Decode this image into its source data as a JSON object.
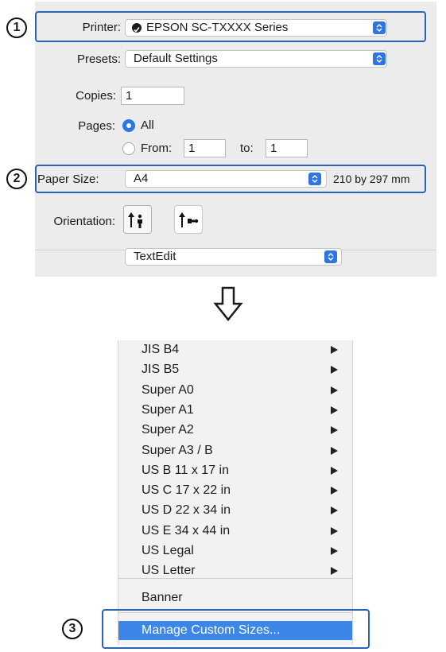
{
  "dialog": {
    "printer_label": "Printer:",
    "printer_value": "EPSON SC-TXXXX Series",
    "presets_label": "Presets:",
    "presets_value": "Default Settings",
    "copies_label": "Copies:",
    "copies_value": "1",
    "pages_label": "Pages:",
    "pages_all_label": "All",
    "pages_from_label": "From:",
    "pages_from_value": "1",
    "pages_to_label": "to:",
    "pages_to_value": "1",
    "paper_size_label": "Paper Size:",
    "paper_size_value": "A4",
    "paper_size_dimensions": "210 by 297 mm",
    "orientation_label": "Orientation:",
    "app_section_value": "TextEdit"
  },
  "callouts": {
    "step1": "1",
    "step2": "2",
    "step3": "3"
  },
  "menu": {
    "items": [
      "JIS B4",
      "JIS B5",
      "Super A0",
      "Super A1",
      "Super A2",
      "Super A3 / B",
      "US B 11 x 17 in",
      "US C 17 x 22 in",
      "US D 22 x 34 in",
      "US E 34 x 44 in",
      "US Legal",
      "US Letter"
    ],
    "banner": "Banner",
    "manage_custom": "Manage Custom Sizes..."
  },
  "colors": {
    "accent": "#2d74e6",
    "callout_border": "#2b63b7",
    "menu_highlight": "#3b86e8",
    "dialog_bg": "#ececec"
  },
  "icons": [
    "arrow-down-icon",
    "portrait-orientation-icon",
    "landscape-orientation-icon",
    "stepper-icon",
    "printer-status-icon",
    "submenu-arrow-icon"
  ]
}
